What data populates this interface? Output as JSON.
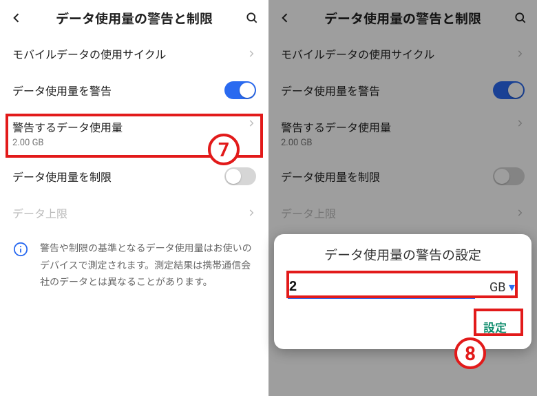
{
  "header": {
    "title": "データ使用量の警告と制限"
  },
  "rows": {
    "cycle": {
      "label": "モバイルデータの使用サイクル"
    },
    "warn": {
      "label": "データ使用量を警告"
    },
    "warnAmt": {
      "label": "警告するデータ使用量",
      "sub": "2.00 GB"
    },
    "limit": {
      "label": "データ使用量を制限"
    },
    "cap": {
      "label": "データ上限"
    }
  },
  "info": {
    "text": "警告や制限の基準となるデータ使用量はお使いのデバイスで測定されます。測定結果は携帯通信会社のデータとは異なることがあります。"
  },
  "dialog": {
    "title": "データ使用量の警告の設定",
    "value": "2",
    "unit": "GB",
    "ok": "設定"
  },
  "badges": {
    "seven": "7",
    "eight": "8"
  }
}
